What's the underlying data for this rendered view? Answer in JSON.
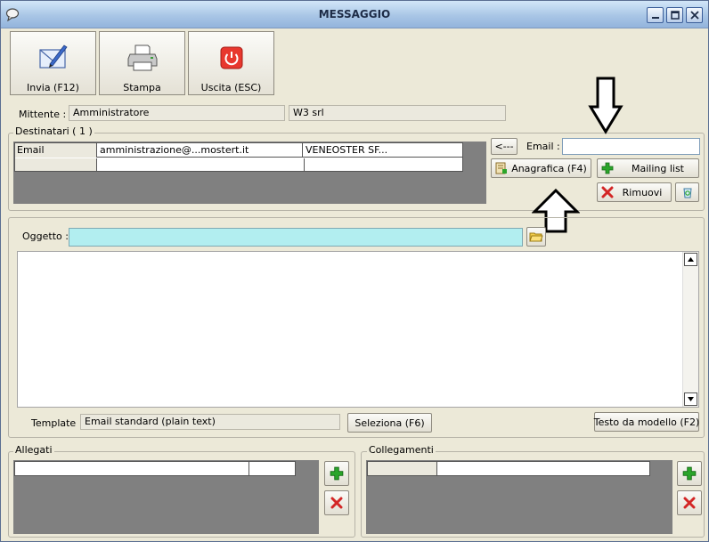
{
  "window": {
    "title": "MESSAGGIO"
  },
  "toolbar": {
    "send_label": "Invia (F12)",
    "print_label": "Stampa",
    "exit_label": "Uscita (ESC)"
  },
  "sender": {
    "label": "Mittente :",
    "name": "Amministratore",
    "company": "W3 srl"
  },
  "recipients": {
    "group_title": "Destinatari ( 1 )",
    "rows": [
      {
        "type": "Email",
        "address": "amministrazione@...mostert.it",
        "name": "VENEOSTER SF..."
      }
    ],
    "back_button": "<---",
    "email_label": "Email :",
    "email_value": "",
    "anagrafica_button": "Anagrafica (F4)",
    "mailing_button": "Mailing list",
    "remove_button": "Rimuovi"
  },
  "message": {
    "subject_label": "Oggetto :",
    "subject_value": "",
    "body": "",
    "template_label": "Template :",
    "template_value": "Email standard (plain text)",
    "select_button": "Seleziona (F6)",
    "template_text_button": "Testo da modello (F2)"
  },
  "attachments": {
    "group_title": "Allegati"
  },
  "links": {
    "group_title": "Collegamenti"
  },
  "colors": {
    "subject_bg": "#b2eef0",
    "grid_grey": "#808080",
    "window_bg": "#ece9d8",
    "add_green": "#2aa52a",
    "remove_red": "#d32626"
  }
}
